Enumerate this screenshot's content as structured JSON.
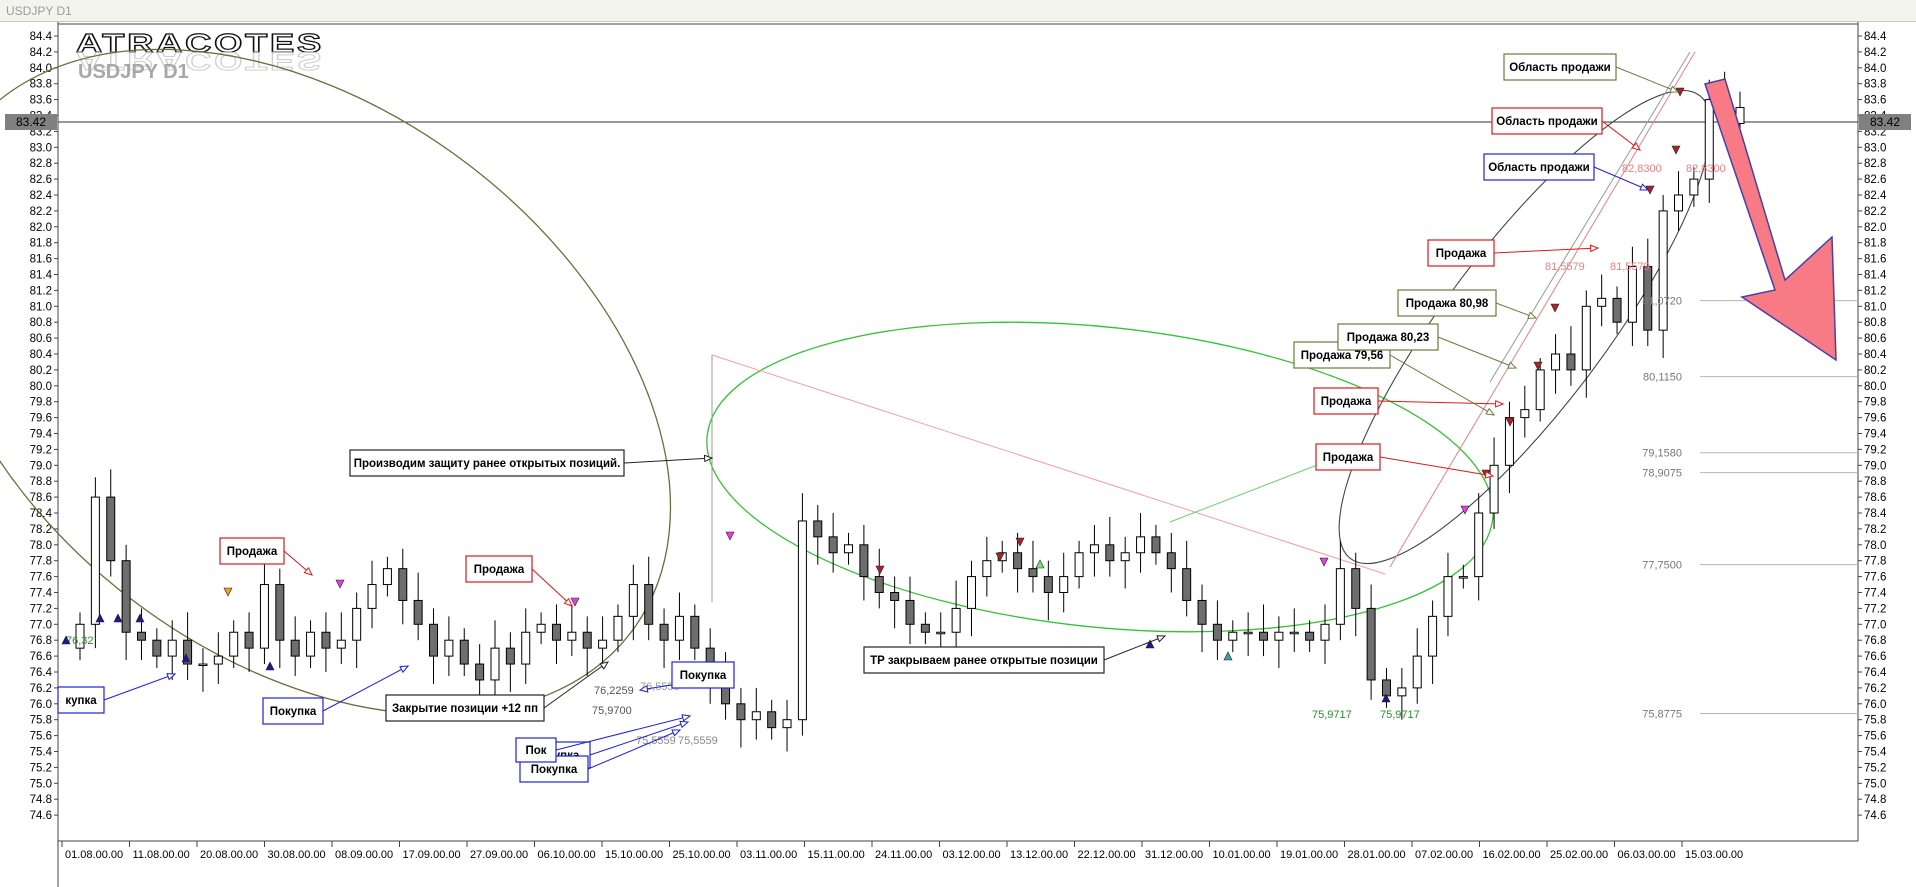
{
  "window": {
    "title": "USDJPY D1"
  },
  "logo": {
    "brand": "ATRACOTES"
  },
  "symbol_label": "USDJPY D1",
  "current_price": "83.42",
  "colors": {
    "bull_candle": "#ffffff",
    "bear_candle": "#6e6e6e",
    "sell_box": "#e0161b",
    "buy_box": "#1e22d4",
    "neutral_box": "#6b7a3c",
    "ellipse_dark": "#6e6c3a",
    "ellipse_green": "#35c235",
    "arrow_fill": "#f87a84",
    "arrow_stroke": "#4a3ea8"
  },
  "chart_data": {
    "type": "candlestick",
    "symbol": "USDJPY",
    "timeframe": "D1",
    "ylim": [
      74.4,
      84.6
    ],
    "y_ticks": [
      "84.4",
      "84.2",
      "84.0",
      "83.8",
      "83.6",
      "83.4",
      "83.2",
      "83.0",
      "82.8",
      "82.6",
      "82.4",
      "82.2",
      "82.0",
      "81.8",
      "81.6",
      "81.4",
      "81.2",
      "81.0",
      "80.8",
      "80.6",
      "80.4",
      "80.2",
      "80.0",
      "79.8",
      "79.6",
      "79.4",
      "79.2",
      "79.0",
      "78.8",
      "78.6",
      "78.4",
      "78.2",
      "78.0",
      "77.8",
      "77.6",
      "77.4",
      "77.2",
      "77.0",
      "76.8",
      "76.6",
      "76.4",
      "76.2",
      "76.0",
      "75.8",
      "75.6",
      "75.4",
      "75.2",
      "75.0",
      "74.8",
      "74.6"
    ],
    "x_ticks": [
      "01.08.00.00",
      "11.08.00.00",
      "20.08.00.00",
      "30.08.00.00",
      "08.09.00.00",
      "17.09.00.00",
      "27.09.00.00",
      "06.10.00.00",
      "15.10.00.00",
      "25.10.00.00",
      "03.11.00.00",
      "15.11.00.00",
      "24.11.00.00",
      "03.12.00.00",
      "13.12.00.00",
      "22.12.00.00",
      "31.12.00.00",
      "10.01.00.00",
      "19.01.00.00",
      "28.01.00.00",
      "07.02.00.00",
      "16.02.00.00",
      "25.02.00.00",
      "06.03.00.00",
      "15.03.00.00"
    ],
    "close_path": [
      77.0,
      78.6,
      77.8,
      76.9,
      76.8,
      76.6,
      76.8,
      76.5,
      76.5,
      76.6,
      76.9,
      76.7,
      77.5,
      76.8,
      76.6,
      76.9,
      76.7,
      76.8,
      77.2,
      77.5,
      77.7,
      77.3,
      77.0,
      76.6,
      76.8,
      76.5,
      76.3,
      76.7,
      76.5,
      76.9,
      77.0,
      76.8,
      76.9,
      76.7,
      76.8,
      77.1,
      77.5,
      77.0,
      76.8,
      77.1,
      76.7,
      76.3,
      76.0,
      75.8,
      75.9,
      75.7,
      75.8,
      78.3,
      78.1,
      77.9,
      78.0,
      77.6,
      77.4,
      77.3,
      77.0,
      76.9,
      76.9,
      77.2,
      77.6,
      77.8,
      77.9,
      77.7,
      77.6,
      77.4,
      77.6,
      77.9,
      78.0,
      77.8,
      77.9,
      78.1,
      77.9,
      77.7,
      77.3,
      77.0,
      76.8,
      76.9,
      76.9,
      76.8,
      76.9,
      76.9,
      76.8,
      77.0,
      77.7,
      77.2,
      76.3,
      76.1,
      76.2,
      76.6,
      77.1,
      77.6,
      77.6,
      78.4,
      79.0,
      79.6,
      79.7,
      80.2,
      80.4,
      80.2,
      81.0,
      81.1,
      80.8,
      81.5,
      80.7,
      82.2,
      82.4,
      82.6,
      83.6,
      83.3,
      83.5
    ],
    "signals": [
      {
        "label": "Продажа",
        "kind": "sell"
      },
      {
        "label": "Продажа",
        "kind": "sell"
      },
      {
        "label": "Покупка",
        "kind": "buy"
      },
      {
        "label": "купка",
        "kind": "buy"
      },
      {
        "label": "Покупка",
        "kind": "buy"
      },
      {
        "label": "Покупка",
        "kind": "buy"
      },
      {
        "label": "Покупка",
        "kind": "buy"
      },
      {
        "label": "Пок",
        "kind": "buy"
      },
      {
        "label": "Закрытие позиции +12 пп",
        "kind": "note"
      },
      {
        "label": "Производим защиту ранее открытых позиций.",
        "kind": "note"
      },
      {
        "label": "TP закрываем ранее открытые позиции",
        "kind": "note"
      },
      {
        "label": "Продажа",
        "kind": "sell"
      },
      {
        "label": "Продажа",
        "kind": "sell"
      },
      {
        "label": "Продажа 79,56",
        "kind": "neutral"
      },
      {
        "label": "Продажа 80,23",
        "kind": "neutral"
      },
      {
        "label": "Продажа 80,98",
        "kind": "neutral"
      },
      {
        "label": "Продажа",
        "kind": "sell"
      },
      {
        "label": "Область продажи",
        "kind": "buy"
      },
      {
        "label": "Область продажи",
        "kind": "sell"
      },
      {
        "label": "Область продажи",
        "kind": "neutral"
      }
    ],
    "level_labels": [
      {
        "text": "76,2259",
        "color": "#555555"
      },
      {
        "text": "75,9700",
        "color": "#555555"
      },
      {
        "text": "76,5559",
        "color": "#999999"
      },
      {
        "text": "75,5559",
        "color": "#888888"
      },
      {
        "text": "75,5559",
        "color": "#888888"
      },
      {
        "text": "75,9717",
        "color": "#2e8b2e"
      },
      {
        "text": "75,9717",
        "color": "#2e8b2e"
      },
      {
        "text": "81,5579",
        "color": "#e88080"
      },
      {
        "text": "81,5579",
        "color": "#e88080"
      },
      {
        "text": "82,8300",
        "color": "#e88080"
      },
      {
        "text": "82,8300",
        "color": "#e88080"
      },
      {
        "text": "76,32",
        "color": "#2e8b2e"
      }
    ],
    "price_levels": [
      {
        "value": 81.072,
        "label": "81,0720"
      },
      {
        "value": 80.115,
        "label": "80,1150"
      },
      {
        "value": 79.158,
        "label": "79,1580"
      },
      {
        "value": 78.9075,
        "label": "78,9075"
      },
      {
        "value": 77.75,
        "label": "77,7500"
      },
      {
        "value": 75.8775,
        "label": "75,8775"
      }
    ]
  }
}
